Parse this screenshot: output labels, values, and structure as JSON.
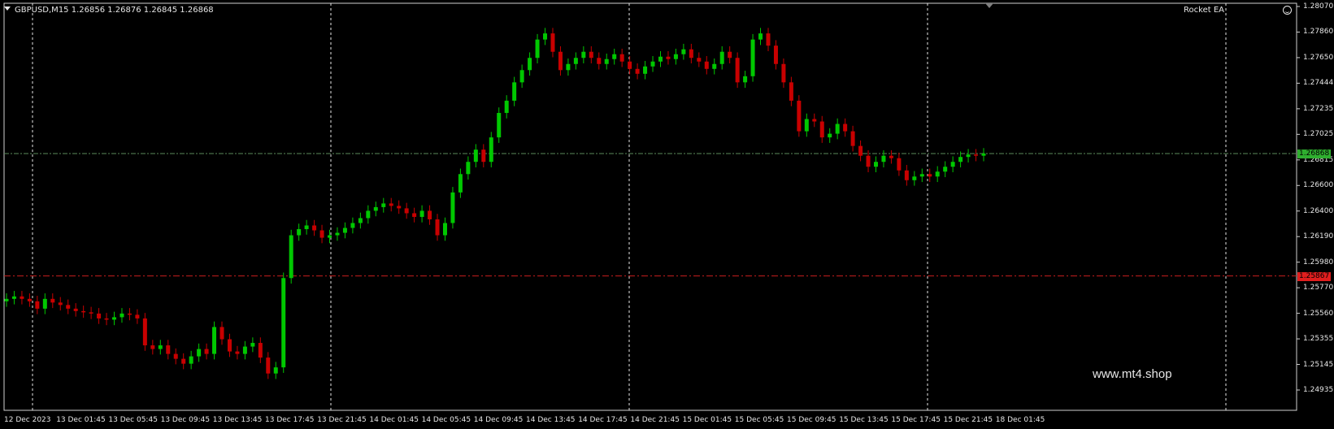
{
  "header": {
    "symbol_info": "GBPUSD,M15  1.26856 1.26876 1.26845 1.26868",
    "ea_label": "Rocket EA"
  },
  "watermark": "www.mt4.shop",
  "price_axis": [
    "1.28070",
    "1.27860",
    "1.27650",
    "1.27444",
    "1.27235",
    "1.27025",
    "1.26815",
    "1.26600",
    "1.26400",
    "1.26190",
    "1.25980",
    "1.25770",
    "1.25560",
    "1.25355",
    "1.25145",
    "1.24935"
  ],
  "time_axis": [
    "12 Dec 2023",
    "13 Dec 01:45",
    "13 Dec 05:45",
    "13 Dec 09:45",
    "13 Dec 13:45",
    "13 Dec 17:45",
    "13 Dec 21:45",
    "14 Dec 01:45",
    "14 Dec 05:45",
    "14 Dec 09:45",
    "14 Dec 13:45",
    "14 Dec 17:45",
    "14 Dec 21:45",
    "15 Dec 01:45",
    "15 Dec 05:45",
    "15 Dec 09:45",
    "15 Dec 13:45",
    "15 Dec 17:45",
    "15 Dec 21:45",
    "18 Dec 01:45"
  ],
  "levels": {
    "bid": "1.26868",
    "stop": "1.25867"
  },
  "colors": {
    "bull": "#00c800",
    "bear": "#c80000",
    "bid_line": "#5a8a5a",
    "bid_tag": "#2fae2f",
    "stop_line": "#c81e1e",
    "stop_tag": "#e01e1e",
    "grid": "#e6e6e6"
  },
  "chart_data": {
    "type": "candlestick",
    "symbol": "GBPUSD",
    "timeframe": "M15",
    "ylim": [
      1.24935,
      1.2807
    ],
    "ohlc_last": {
      "open": 1.26856,
      "high": 1.26876,
      "low": 1.26845,
      "close": 1.26868
    },
    "close_series": [
      1.2568,
      1.257,
      1.2568,
      1.2566,
      1.256,
      1.2568,
      1.2565,
      1.2563,
      1.256,
      1.2558,
      1.2557,
      1.2556,
      1.2552,
      1.2551,
      1.2553,
      1.2556,
      1.2555,
      1.2552,
      1.253,
      1.2527,
      1.253,
      1.2523,
      1.2519,
      1.2515,
      1.2521,
      1.2527,
      1.2523,
      1.2545,
      1.2535,
      1.2525,
      1.2523,
      1.2529,
      1.2532,
      1.252,
      1.2507,
      1.2512,
      1.2585,
      1.262,
      1.2625,
      1.2628,
      1.2624,
      1.2618,
      1.262,
      1.2622,
      1.2626,
      1.263,
      1.2634,
      1.264,
      1.2643,
      1.2646,
      1.2644,
      1.2642,
      1.2638,
      1.2635,
      1.264,
      1.2633,
      1.262,
      1.263,
      1.2655,
      1.267,
      1.268,
      1.269,
      1.268,
      1.27,
      1.272,
      1.273,
      1.2745,
      1.2755,
      1.2765,
      1.278,
      1.2785,
      1.277,
      1.2755,
      1.276,
      1.2765,
      1.277,
      1.2765,
      1.276,
      1.2764,
      1.2768,
      1.2762,
      1.2756,
      1.2752,
      1.2758,
      1.2762,
      1.2766,
      1.2764,
      1.2768,
      1.2772,
      1.2765,
      1.2762,
      1.2756,
      1.276,
      1.277,
      1.2765,
      1.2745,
      1.275,
      1.278,
      1.2785,
      1.2775,
      1.276,
      1.2745,
      1.273,
      1.2705,
      1.2715,
      1.2713,
      1.27,
      1.2703,
      1.2711,
      1.2705,
      1.2693,
      1.2685,
      1.2676,
      1.268,
      1.2685,
      1.2683,
      1.2673,
      1.2665,
      1.2668,
      1.267,
      1.2668,
      1.2672,
      1.2676,
      1.268,
      1.2684,
      1.2686,
      1.2685,
      1.26868
    ]
  }
}
